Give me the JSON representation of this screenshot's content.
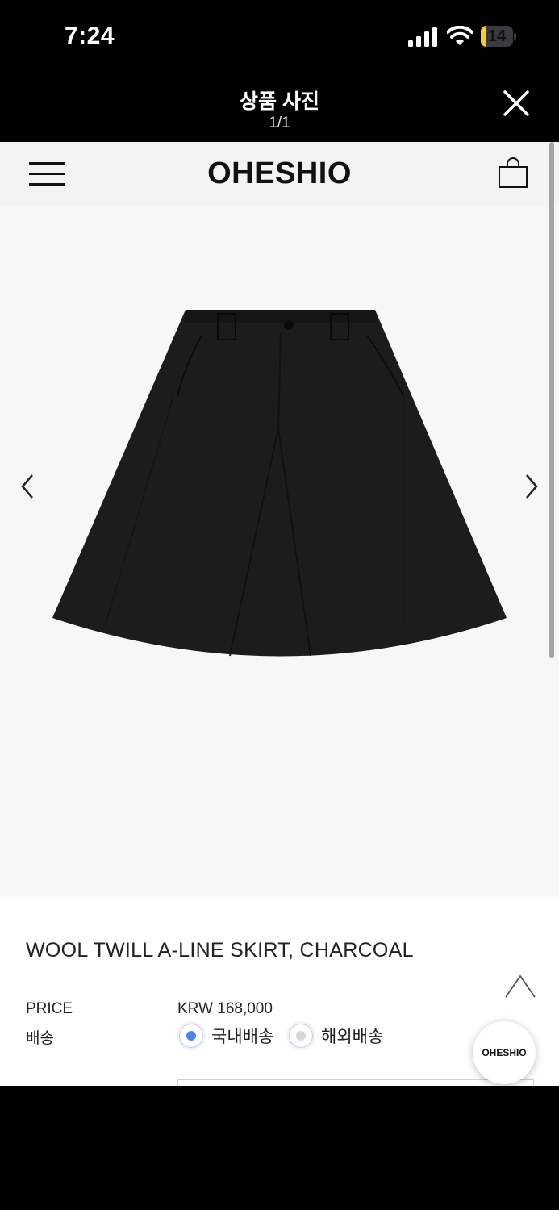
{
  "status_bar": {
    "time": "7:24",
    "battery": "14",
    "battery_level": 0.14
  },
  "viewer": {
    "title": "상품 사진",
    "counter": "1/1"
  },
  "site": {
    "brand": "OHESHIO"
  },
  "product": {
    "name": "WOOL TWILL A-LINE SKIRT, CHARCOAL",
    "price_label": "PRICE",
    "price_value": "KRW 168,000",
    "shipping_label": "배송",
    "shipping_options": [
      {
        "label": "국내배송",
        "selected": true
      },
      {
        "label": "해외배송",
        "selected": false
      }
    ]
  },
  "floating": {
    "brand_bubble": "OHESHIO"
  },
  "colors": {
    "accent_radio": "#4a86e8",
    "inactive_radio": "#d6d6d6",
    "skirt": "#1c1c1c",
    "gallery_bg": "#f7f7f7"
  },
  "icons": [
    "signal-icon",
    "wifi-icon",
    "battery-icon",
    "close-icon",
    "menu-icon",
    "shopping-bag-icon",
    "chevron-left-icon",
    "chevron-right-icon",
    "scroll-top-icon"
  ]
}
